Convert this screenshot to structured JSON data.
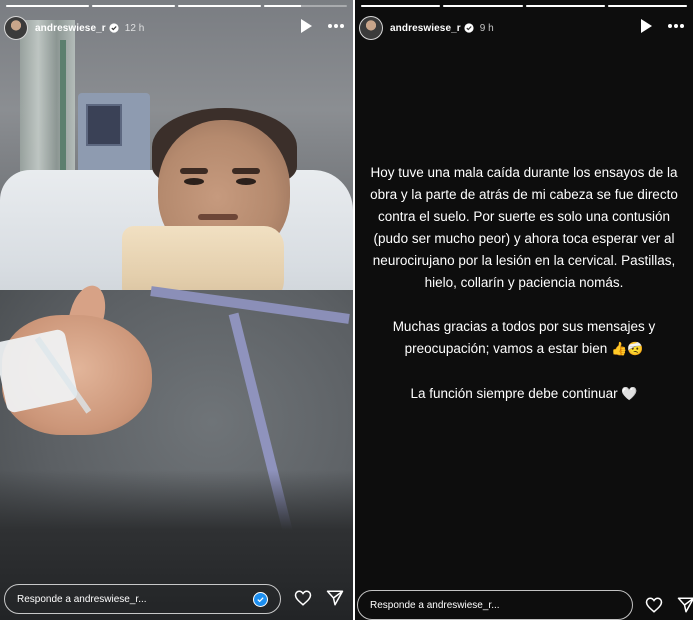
{
  "stories": [
    {
      "id": "left",
      "progress": [
        1,
        1,
        1,
        0.45
      ],
      "username": "andreswiese_r",
      "time": "12 h",
      "reply_placeholder": "Responde a andreswiese_r..."
    },
    {
      "id": "right",
      "progress": [
        1,
        1,
        1,
        1
      ],
      "username": "andreswiese_r",
      "time": "9 h",
      "reply_placeholder": "Responde a andreswiese_r...",
      "text": {
        "p1": "Hoy tuve una mala caída durante los ensayos de la obra y la parte de atrás de mi cabeza se fue directo contra el suelo. Por suerte es solo una contusión (pudo ser mucho peor) y ahora toca esperar ver al neurocirujano por la lesión en la cervical. Pastillas, hielo, collarín y paciencia nomás.",
        "p2": "Muchas gracias a todos por sus mensajes y preocupación; vamos a estar bien",
        "p2_emoji": "👍🤕",
        "p3": "La función siempre debe continuar",
        "p3_emoji": "🤍"
      }
    }
  ],
  "icons": {
    "verified": "verified-badge-icon",
    "play": "play-icon",
    "more": "more-icon",
    "heart": "heart-icon",
    "send": "send-icon"
  },
  "colors": {
    "verified_blue": "#1d8ff0",
    "right_story_bg": "#0d0d0d"
  }
}
